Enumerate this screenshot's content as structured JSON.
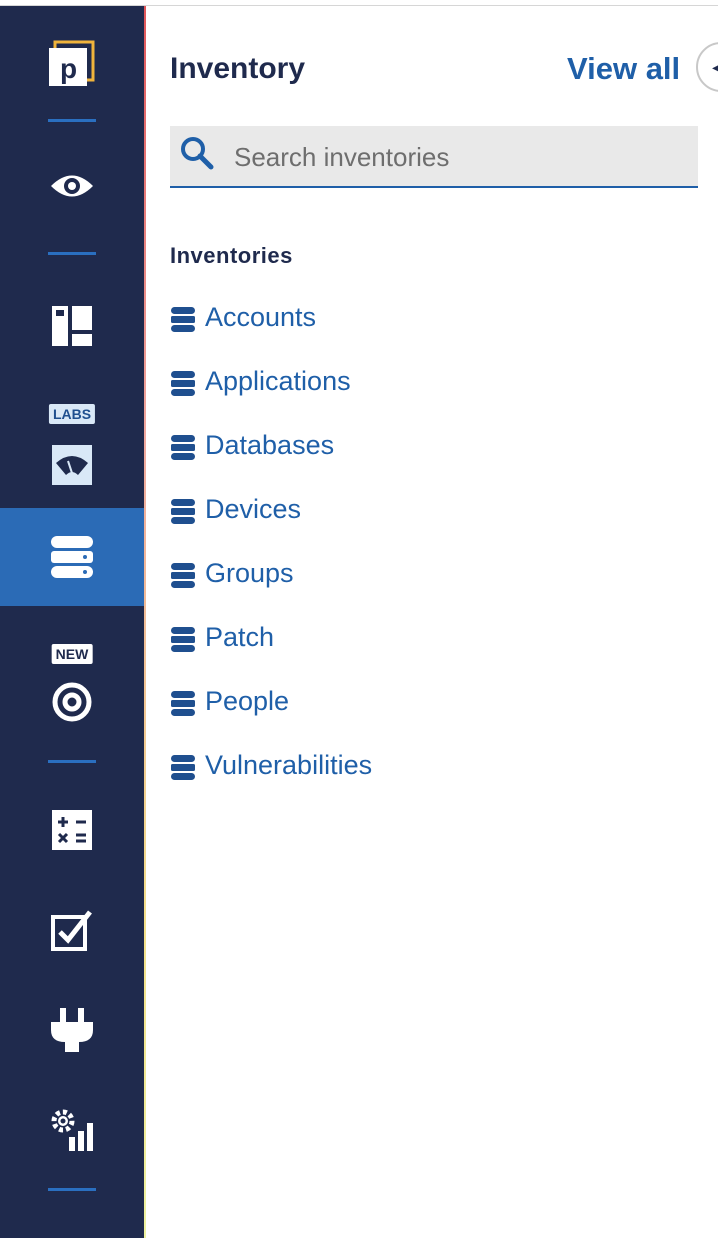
{
  "sidebar": {
    "items": [
      {
        "icon": "logo-icon"
      },
      {
        "icon": "eye-icon"
      },
      {
        "icon": "dashboard-icon"
      },
      {
        "icon": "gauge-icon",
        "tag": "LABS"
      },
      {
        "icon": "database-icon",
        "active": true
      },
      {
        "icon": "target-icon",
        "tag": "NEW"
      },
      {
        "icon": "calculator-icon"
      },
      {
        "icon": "checkbox-icon"
      },
      {
        "icon": "plug-icon"
      },
      {
        "icon": "gear-chart-icon"
      }
    ],
    "labs_tag": "LABS",
    "new_tag": "NEW"
  },
  "panel": {
    "title": "Inventory",
    "view_all": "View all",
    "search": {
      "placeholder": "Search inventories",
      "value": ""
    },
    "section_label": "Inventories",
    "inventories": [
      {
        "label": "Accounts"
      },
      {
        "label": "Applications"
      },
      {
        "label": "Databases"
      },
      {
        "label": "Devices"
      },
      {
        "label": "Groups"
      },
      {
        "label": "Patch"
      },
      {
        "label": "People"
      },
      {
        "label": "Vulnerabilities"
      }
    ]
  },
  "colors": {
    "sidebar_bg": "#1f2a4d",
    "sidebar_active": "#2b6bb6",
    "accent": "#1f5fa8",
    "separator": "#2a6fc0"
  }
}
